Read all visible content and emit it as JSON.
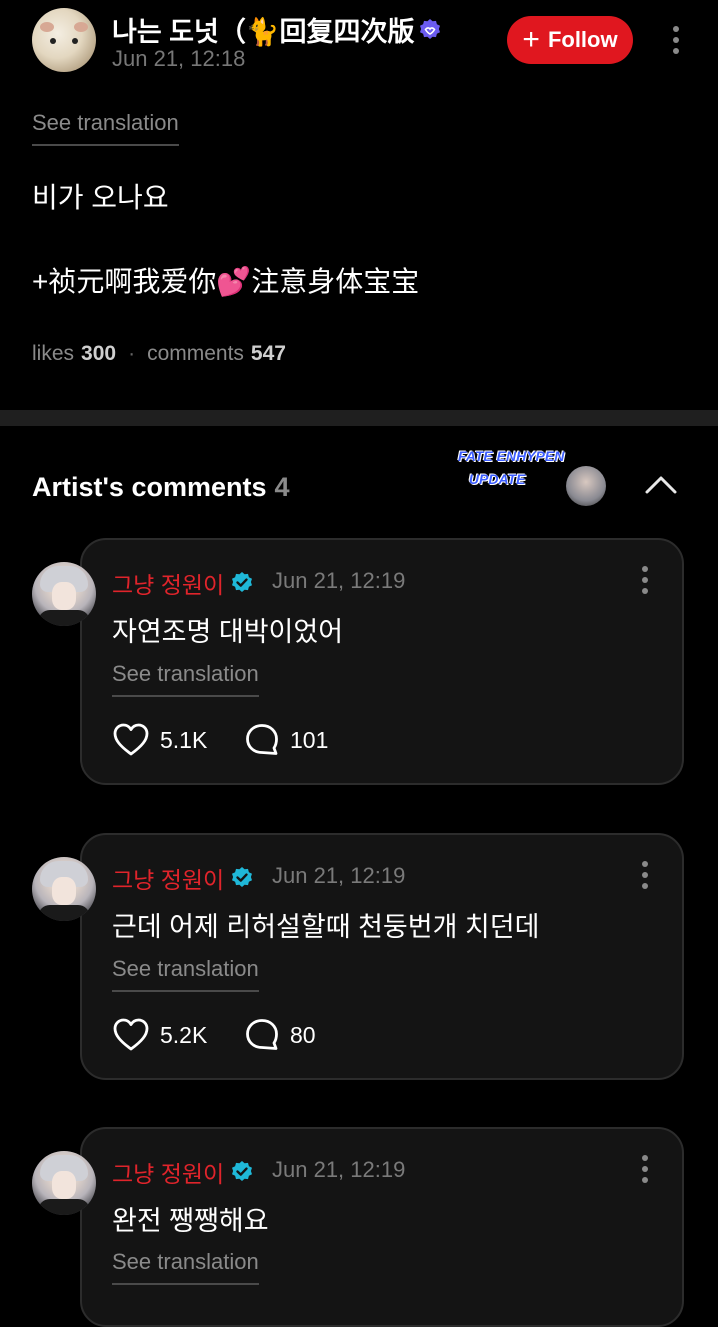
{
  "post": {
    "author": "나는 도넛（🐈回复四次版",
    "date": "Jun 21, 12:18",
    "follow_label": "Follow",
    "see_translation": "See translation",
    "lines": [
      "비가 오나요",
      "+祯元啊我爱你💕注意身体宝宝"
    ],
    "likes_label": "likes",
    "likes": "300",
    "comments_label": "comments",
    "comments": "547"
  },
  "artist_section": {
    "title": "Artist's comments",
    "count": "4",
    "watermark_line1": "FATE ENHYPEN",
    "watermark_line2": "UPDATE"
  },
  "comments": [
    {
      "name": "그냥 정원이",
      "date": "Jun 21, 12:19",
      "text": "자연조명 대박이었어",
      "see_translation": "See translation",
      "likes": "5.1K",
      "replies": "101"
    },
    {
      "name": "그냥 정원이",
      "date": "Jun 21, 12:19",
      "text": "근데 어제 리허설할때 천둥번개 치던데",
      "see_translation": "See translation",
      "likes": "5.2K",
      "replies": "80"
    },
    {
      "name": "그냥 정원이",
      "date": "Jun 21, 12:19",
      "text": "완전 쨍쨍해요",
      "see_translation": "See translation"
    }
  ],
  "colors": {
    "accent_red": "#e0171f",
    "artist_name_red": "#e0242b",
    "verified_blue": "#1fb8d8",
    "verified_purple": "#6b5cf0"
  },
  "icons": [
    "more-vertical-icon",
    "plus-icon",
    "verified-badge-icon",
    "chevron-up-icon",
    "heart-icon",
    "comment-bubble-icon"
  ]
}
